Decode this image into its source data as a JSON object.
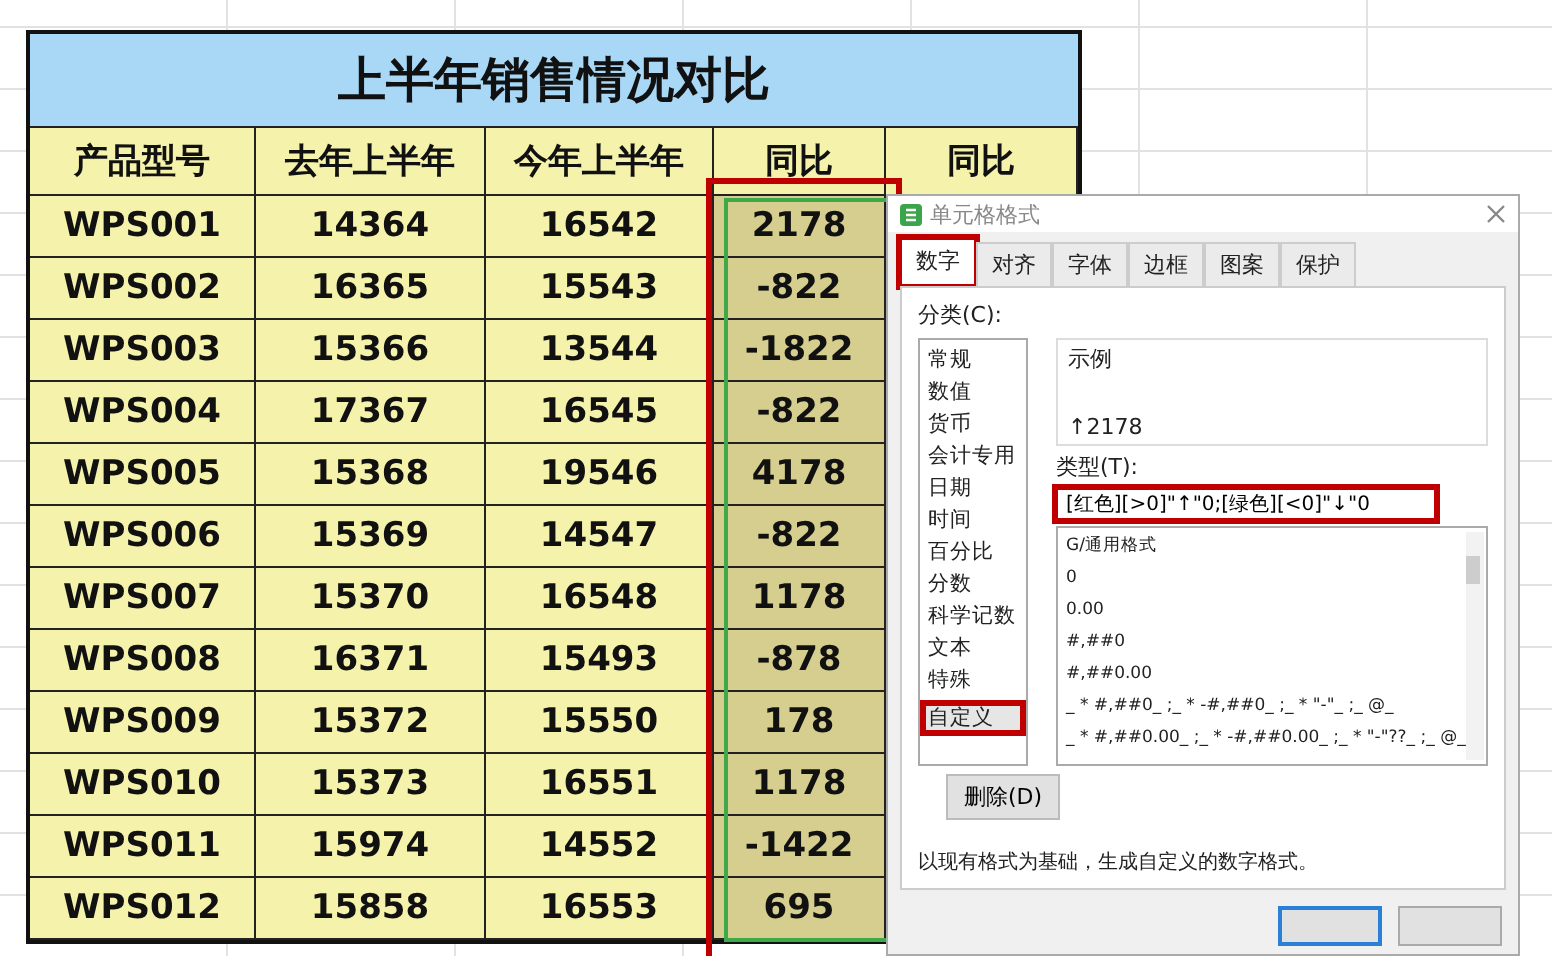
{
  "sheet": {
    "title": "上半年销售情况对比",
    "columns": [
      "产品型号",
      "去年上半年",
      "今年上半年",
      "同比",
      "同比"
    ],
    "fourth_column": {
      "selected": true,
      "highlighted": true
    },
    "rows": [
      [
        "WPS001",
        "14364",
        "16542",
        "2178"
      ],
      [
        "WPS002",
        "16365",
        "15543",
        "-822"
      ],
      [
        "WPS003",
        "15366",
        "13544",
        "-1822"
      ],
      [
        "WPS004",
        "17367",
        "16545",
        "-822"
      ],
      [
        "WPS005",
        "15368",
        "19546",
        "4178"
      ],
      [
        "WPS006",
        "15369",
        "14547",
        "-822"
      ],
      [
        "WPS007",
        "15370",
        "16548",
        "1178"
      ],
      [
        "WPS008",
        "16371",
        "15493",
        "-878"
      ],
      [
        "WPS009",
        "15372",
        "15550",
        "178"
      ],
      [
        "WPS010",
        "15373",
        "16551",
        "1178"
      ],
      [
        "WPS011",
        "15974",
        "14552",
        "-1422"
      ],
      [
        "WPS012",
        "15858",
        "16553",
        "695"
      ]
    ]
  },
  "dialog": {
    "title": "单元格格式",
    "tabs": [
      {
        "label": "数字",
        "selected": true,
        "highlighted": true
      },
      {
        "label": "对齐",
        "selected": false,
        "highlighted": false
      },
      {
        "label": "字体",
        "selected": false,
        "highlighted": false
      },
      {
        "label": "边框",
        "selected": false,
        "highlighted": false
      },
      {
        "label": "图案",
        "selected": false,
        "highlighted": false
      },
      {
        "label": "保护",
        "selected": false,
        "highlighted": false
      }
    ],
    "category_label": "分类(C):",
    "categories": [
      {
        "label": "常规",
        "selected": false,
        "highlighted": false
      },
      {
        "label": "数值",
        "selected": false,
        "highlighted": false
      },
      {
        "label": "货币",
        "selected": false,
        "highlighted": false
      },
      {
        "label": "会计专用",
        "selected": false,
        "highlighted": false
      },
      {
        "label": "日期",
        "selected": false,
        "highlighted": false
      },
      {
        "label": "时间",
        "selected": false,
        "highlighted": false
      },
      {
        "label": "百分比",
        "selected": false,
        "highlighted": false
      },
      {
        "label": "分数",
        "selected": false,
        "highlighted": false
      },
      {
        "label": "科学记数",
        "selected": false,
        "highlighted": false
      },
      {
        "label": "文本",
        "selected": false,
        "highlighted": false
      },
      {
        "label": "特殊",
        "selected": false,
        "highlighted": false
      },
      {
        "label": "自定义",
        "selected": true,
        "highlighted": true
      }
    ],
    "sample_label": "示例",
    "sample": "↑2178",
    "type_label": "类型(T):",
    "type_value": "[红色][>0]\"↑\"0;[绿色][<0]\"↓\"0",
    "type_highlighted": true,
    "formats": [
      "G/通用格式",
      "0",
      "0.00",
      "#,##0",
      "#,##0.00",
      "_ * #,##0_ ;_ * -#,##0_ ;_ * \"-\"_ ;_ @_",
      "_ * #,##0.00_ ;_ * -#,##0.00_ ;_ * \"-\"??_ ;_ @_"
    ],
    "delete_button": "删除(D)",
    "description": "以现有格式为基础，生成自定义的数字格式。"
  }
}
